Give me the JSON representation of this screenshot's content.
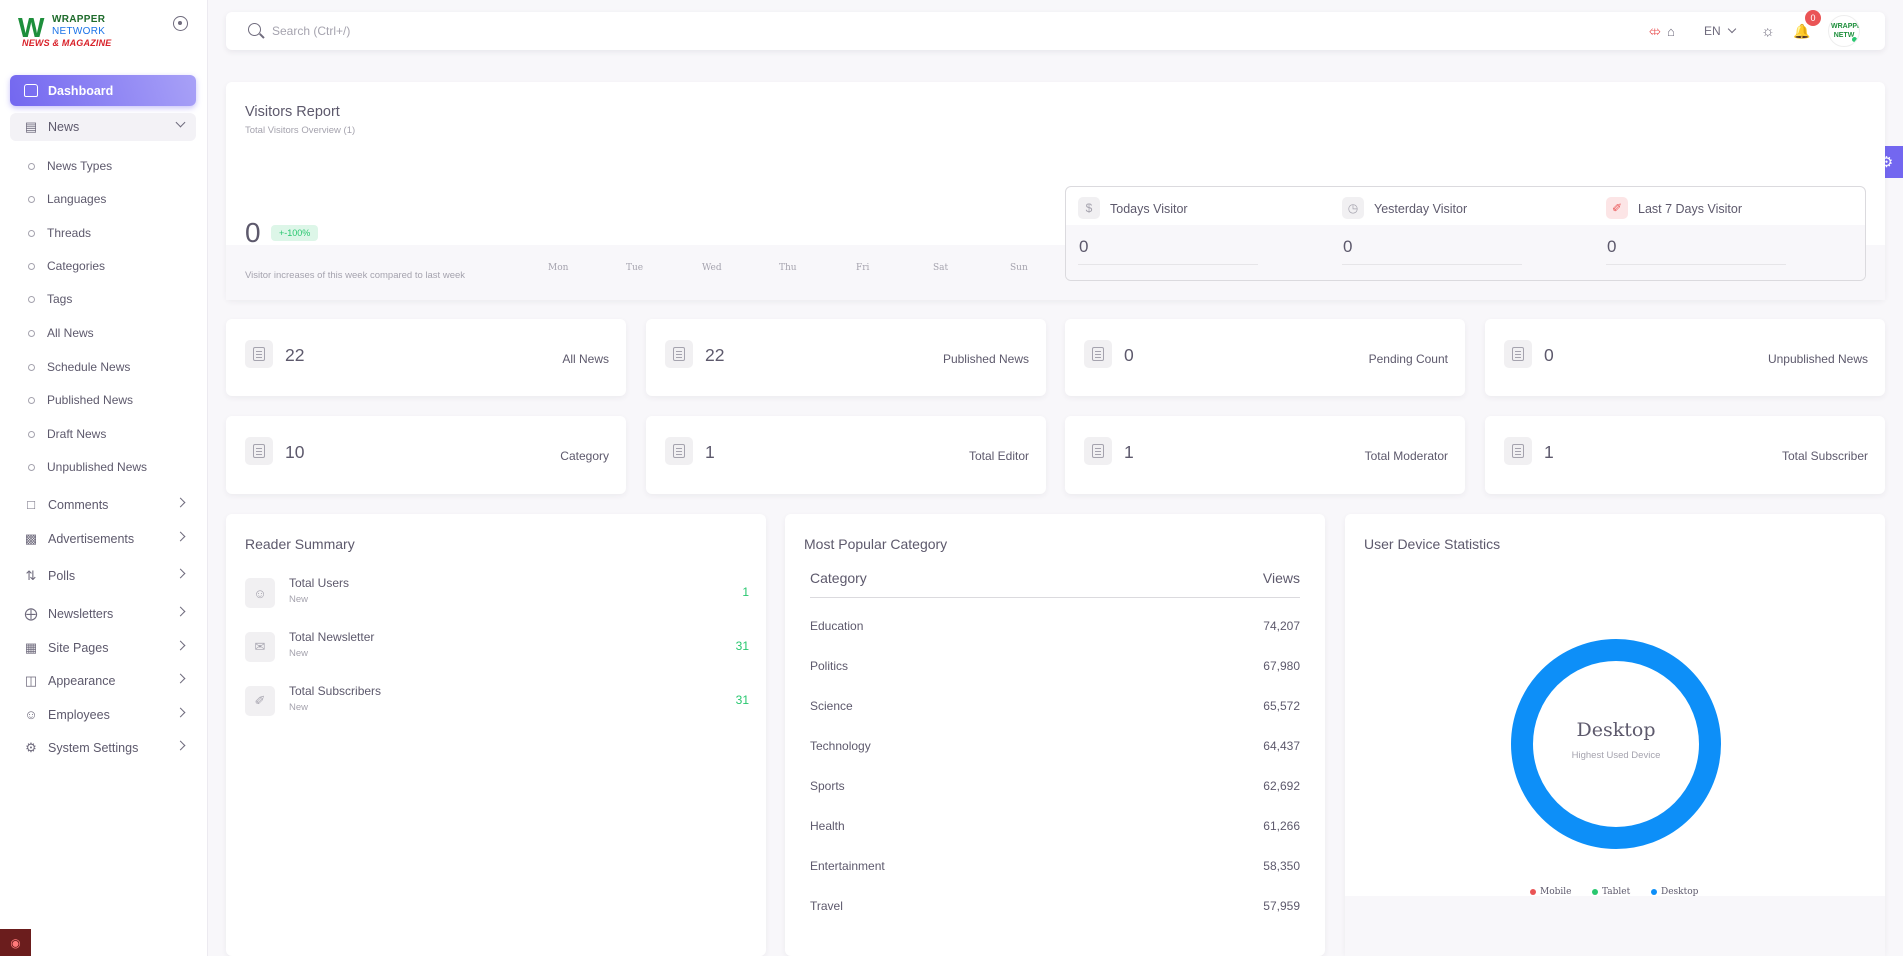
{
  "brand": {
    "line1": "WRAPPER",
    "line2": "NETWORK",
    "tagline": "NEWS & MAGAZINE"
  },
  "sidebar": {
    "active": {
      "label": "Dashboard",
      "icon": "home-icon"
    },
    "news": {
      "label": "News",
      "icon": "newspaper-icon",
      "children": [
        "News Types",
        "Languages",
        "Threads",
        "Categories",
        "Tags",
        "All News",
        "Schedule News",
        "Published News",
        "Draft News",
        "Unpublished News"
      ]
    },
    "items": [
      {
        "label": "Comments",
        "icon": "comment-icon"
      },
      {
        "label": "Advertisements",
        "icon": "ad-icon"
      },
      {
        "label": "Polls",
        "icon": "poll-icon"
      },
      {
        "label": "Newsletters",
        "icon": "pin-icon"
      },
      {
        "label": "Site Pages",
        "icon": "page-icon"
      },
      {
        "label": "Appearance",
        "icon": "layout-icon"
      },
      {
        "label": "Employees",
        "icon": "users-icon"
      },
      {
        "label": "System Settings",
        "icon": "gear-icon"
      }
    ]
  },
  "navbar": {
    "search_placeholder": "Search (Ctrl+/)",
    "language": "EN",
    "notification_count": "0",
    "avatar_text": "WRAPPER NETW"
  },
  "visitors": {
    "title": "Visitors Report",
    "subtitle": "Total Visitors Overview (1)",
    "count": "0",
    "change": "+-100%",
    "note": "Visitor increases of this week compared to last week",
    "days": [
      "Mon",
      "Tue",
      "Wed",
      "Thu",
      "Fri",
      "Sat",
      "Sun"
    ],
    "stats": [
      {
        "label": "Todays Visitor",
        "value": "0",
        "icon": "dollar-icon"
      },
      {
        "label": "Yesterday Visitor",
        "value": "0",
        "icon": "clock-icon"
      },
      {
        "label": "Last 7 Days Visitor",
        "value": "0",
        "icon": "brush-icon"
      }
    ]
  },
  "stats": [
    {
      "value": "22",
      "label": "All News"
    },
    {
      "value": "22",
      "label": "Published News"
    },
    {
      "value": "0",
      "label": "Pending Count"
    },
    {
      "value": "0",
      "label": "Unpublished News"
    },
    {
      "value": "10",
      "label": "Category"
    },
    {
      "value": "1",
      "label": "Total Editor"
    },
    {
      "value": "1",
      "label": "Total Moderator"
    },
    {
      "value": "1",
      "label": "Total Subscriber"
    }
  ],
  "reader_summary": {
    "title": "Reader Summary",
    "rows": [
      {
        "title": "Total Users",
        "sub": "New",
        "value": "1",
        "icon": "users-icon"
      },
      {
        "title": "Total Newsletter",
        "sub": "New",
        "value": "31",
        "icon": "mail-icon"
      },
      {
        "title": "Total Subscribers",
        "sub": "New",
        "value": "31",
        "icon": "brush-icon"
      }
    ]
  },
  "popular_category": {
    "title": "Most Popular Category",
    "col_category": "Category",
    "col_views": "Views",
    "rows": [
      {
        "category": "Education",
        "views": "74,207"
      },
      {
        "category": "Politics",
        "views": "67,980"
      },
      {
        "category": "Science",
        "views": "65,572"
      },
      {
        "category": "Technology",
        "views": "64,437"
      },
      {
        "category": "Sports",
        "views": "62,692"
      },
      {
        "category": "Health",
        "views": "61,266"
      },
      {
        "category": "Entertainment",
        "views": "58,350"
      },
      {
        "category": "Travel",
        "views": "57,959"
      }
    ]
  },
  "device_stats": {
    "title": "User Device Statistics",
    "center_label": "Desktop",
    "center_sub": "Highest Used Device",
    "legend": [
      {
        "label": "Mobile",
        "color": "#ea5455"
      },
      {
        "label": "Tablet",
        "color": "#28c76f"
      },
      {
        "label": "Desktop",
        "color": "#0d8ff8"
      }
    ]
  }
}
